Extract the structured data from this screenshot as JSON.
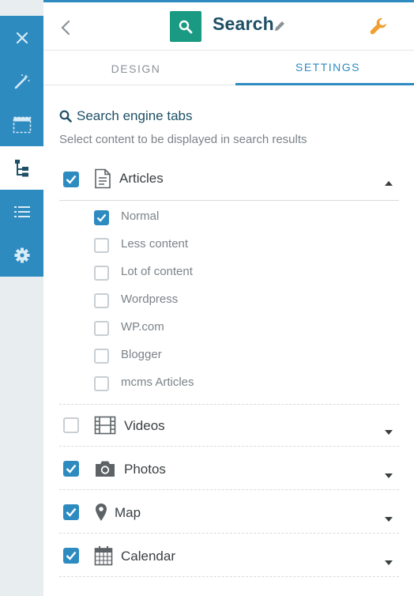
{
  "colors": {
    "accent": "#2e8bc0",
    "search_tile": "#1a9a83",
    "wrench": "#f0a030",
    "title": "#1e4f66"
  },
  "rail": {
    "items": [
      {
        "icon": "close-icon",
        "active": false
      },
      {
        "icon": "magic-wand-icon",
        "active": false
      },
      {
        "icon": "layout-icon",
        "active": false
      },
      {
        "icon": "sitemap-icon",
        "active": true
      },
      {
        "icon": "list-icon",
        "active": false
      },
      {
        "icon": "gear-icon",
        "active": false
      }
    ]
  },
  "header": {
    "title": "Search",
    "tile_icon": "search-icon",
    "tool_icon": "wrench-icon"
  },
  "tabs": [
    {
      "label": "DESIGN",
      "active": false
    },
    {
      "label": "SETTINGS",
      "active": true
    }
  ],
  "section": {
    "title": "Search engine tabs",
    "subtitle": "Select content to be displayed in search results"
  },
  "groups": [
    {
      "label": "Articles",
      "icon": "document-icon",
      "checked": true,
      "expanded": true,
      "items": [
        {
          "label": "Normal",
          "checked": true
        },
        {
          "label": "Less content",
          "checked": false
        },
        {
          "label": "Lot of content",
          "checked": false
        },
        {
          "label": "Wordpress",
          "checked": false
        },
        {
          "label": "WP.com",
          "checked": false
        },
        {
          "label": "Blogger",
          "checked": false
        },
        {
          "label": "mcms Articles",
          "checked": false
        }
      ]
    },
    {
      "label": "Videos",
      "icon": "film-icon",
      "checked": false,
      "expanded": false
    },
    {
      "label": "Photos",
      "icon": "camera-icon",
      "checked": true,
      "expanded": false
    },
    {
      "label": "Map",
      "icon": "map-pin-icon",
      "checked": true,
      "expanded": false
    },
    {
      "label": "Calendar",
      "icon": "calendar-icon",
      "checked": true,
      "expanded": false
    }
  ]
}
